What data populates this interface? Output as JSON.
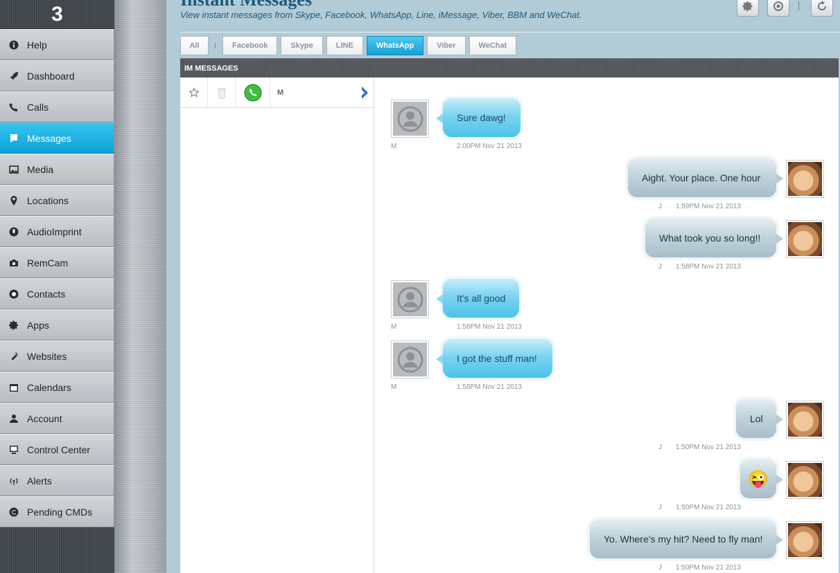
{
  "sidebar": {
    "logo": "3",
    "items": [
      {
        "label": "Help",
        "icon": "info-icon",
        "active": false
      },
      {
        "label": "Dashboard",
        "icon": "rocket-icon",
        "active": false
      },
      {
        "label": "Calls",
        "icon": "phone-icon",
        "active": false
      },
      {
        "label": "Messages",
        "icon": "message-icon",
        "active": true
      },
      {
        "label": "Media",
        "icon": "image-icon",
        "active": false
      },
      {
        "label": "Locations",
        "icon": "pin-icon",
        "active": false
      },
      {
        "label": "AudioImprint",
        "icon": "microphone-icon",
        "active": false
      },
      {
        "label": "RemCam",
        "icon": "camera-icon",
        "active": false
      },
      {
        "label": "Contacts",
        "icon": "contact-icon",
        "active": false
      },
      {
        "label": "Apps",
        "icon": "gear-icon",
        "active": false
      },
      {
        "label": "Websites",
        "icon": "link-icon",
        "active": false
      },
      {
        "label": "Calendars",
        "icon": "calendar-icon",
        "active": false
      },
      {
        "label": "Account",
        "icon": "user-icon",
        "active": false
      },
      {
        "label": "Control Center",
        "icon": "monitor-icon",
        "active": false
      },
      {
        "label": "Alerts",
        "icon": "antenna-icon",
        "active": false
      },
      {
        "label": "Pending CMDs",
        "icon": "pending-icon",
        "active": false
      }
    ]
  },
  "header": {
    "title": "Instant Messages",
    "subtitle": "View instant messages from Skype, Facebook, WhatsApp, Line, iMessage, Viber, BBM and WeChat.",
    "tools": [
      "settings-icon",
      "search-icon",
      "refresh-icon"
    ]
  },
  "tabs": [
    {
      "label": "All",
      "active": false
    },
    {
      "label": "Facebook",
      "active": false
    },
    {
      "label": "Skype",
      "active": false
    },
    {
      "label": "LINE",
      "active": false
    },
    {
      "label": "WhatsApp",
      "active": true
    },
    {
      "label": "Viber",
      "active": false
    },
    {
      "label": "WeChat",
      "active": false
    }
  ],
  "panel": {
    "title": "IM MESSAGES"
  },
  "conversation": {
    "name": "M",
    "app_icon": "whatsapp-icon"
  },
  "messages": [
    {
      "direction": "in",
      "text": "Sure dawg!",
      "sender": "M",
      "time": "2:00PM Nov 21 2013"
    },
    {
      "direction": "out",
      "text": "Aight. Your place. One hour",
      "sender": "J",
      "time": "1:59PM Nov 21 2013"
    },
    {
      "direction": "out",
      "text": "What took you so long!!",
      "sender": "J",
      "time": "1:58PM Nov 21 2013"
    },
    {
      "direction": "in",
      "text": "It's all good",
      "sender": "M",
      "time": "1:58PM Nov 21 2013"
    },
    {
      "direction": "in",
      "text": "I got the stuff man!",
      "sender": "M",
      "time": "1:58PM Nov 21 2013"
    },
    {
      "direction": "out",
      "text": "Lol",
      "sender": "J",
      "time": "1:50PM Nov 21 2013"
    },
    {
      "direction": "out",
      "text": "😜",
      "sender": "J",
      "time": "1:50PM Nov 21 2013"
    },
    {
      "direction": "out",
      "text": "Yo. Where's my hit? Need to fly man!",
      "sender": "J",
      "time": "1:50PM Nov 21 2013"
    }
  ]
}
